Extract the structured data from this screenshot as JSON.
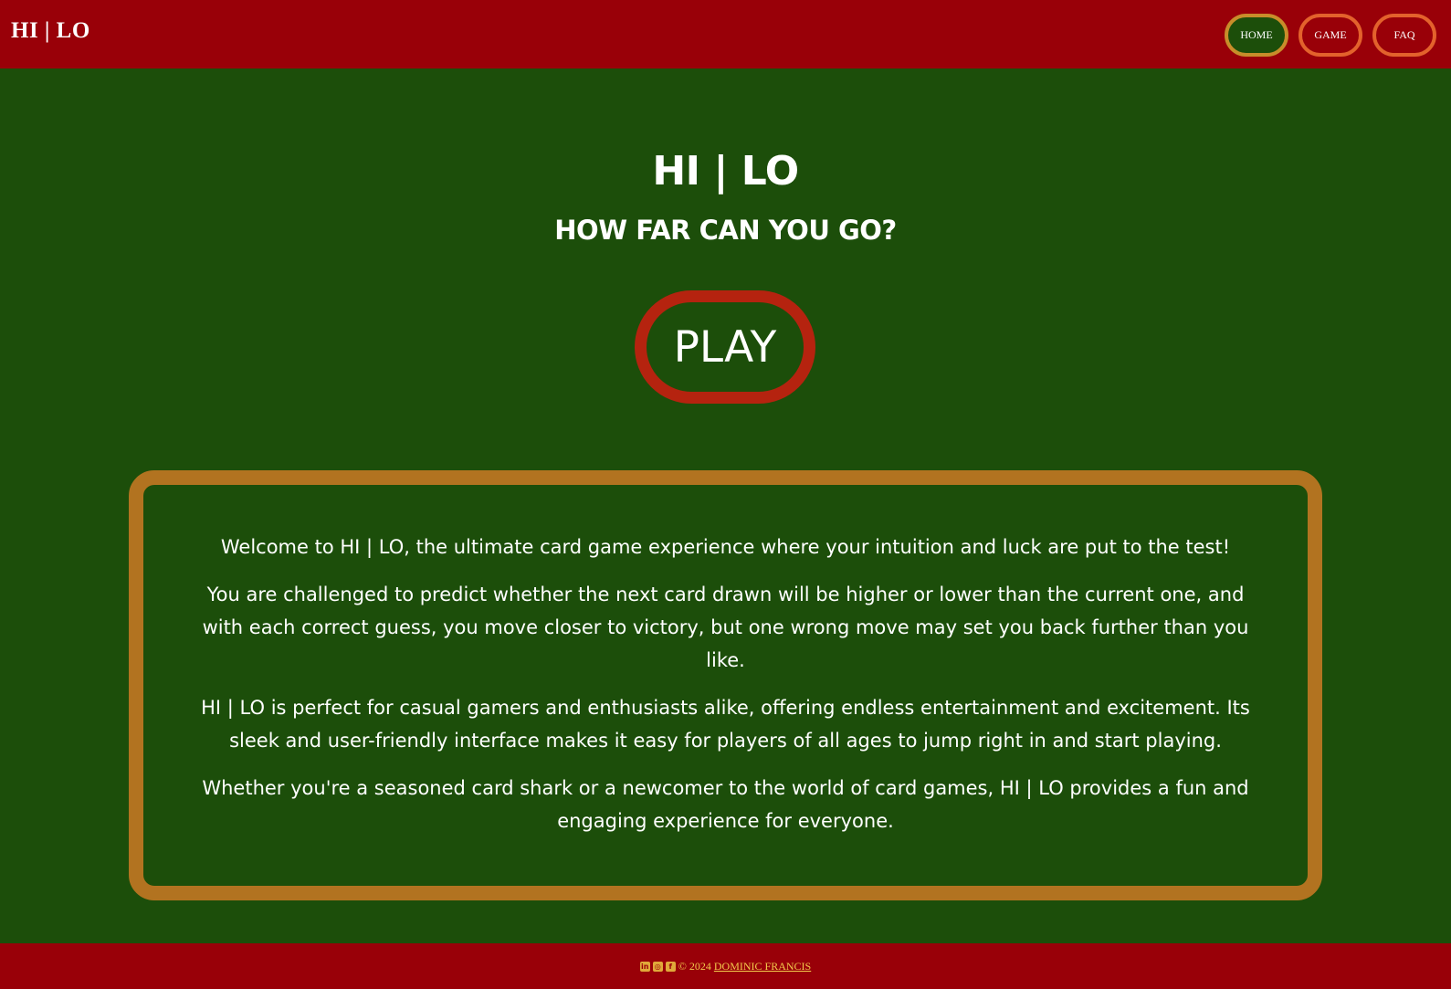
{
  "colors": {
    "navbar_bg": "#990008",
    "page_bg": "#1c4e0a",
    "nav_border": "#e3622c",
    "nav_active_border": "#c88d2a",
    "play_border": "#b5230f",
    "card_border": "#b27320",
    "footer_text": "#f2c94c"
  },
  "navbar": {
    "brand": "HI | LO",
    "links": [
      {
        "label": "HOME",
        "active": true
      },
      {
        "label": "GAME",
        "active": false
      },
      {
        "label": "FAQ",
        "active": false
      }
    ]
  },
  "hero": {
    "title": "HI | LO",
    "subtitle": "HOW FAR CAN YOU GO?",
    "play_label": "PLAY"
  },
  "about": {
    "paragraphs": [
      "Welcome to HI | LO, the ultimate card game experience where your intuition and luck are put to the test!",
      "You are challenged to predict whether the next card drawn will be higher or lower than the current one, and with each correct guess, you move closer to victory, but one wrong move may set you back further than you like.",
      "HI | LO is perfect for casual gamers and enthusiasts alike, offering endless entertainment and excitement. Its sleek and user-friendly interface makes it easy for players of all ages to jump right in and start playing.",
      "Whether you're a seasoned card shark or a newcomer to the world of card games, HI | LO provides a fun and engaging experience for everyone."
    ]
  },
  "footer": {
    "social_icons": [
      "linkedin-icon",
      "instagram-icon",
      "facebook-icon"
    ],
    "copyright": "© 2024",
    "author": "DOMINIC FRANCIS"
  }
}
